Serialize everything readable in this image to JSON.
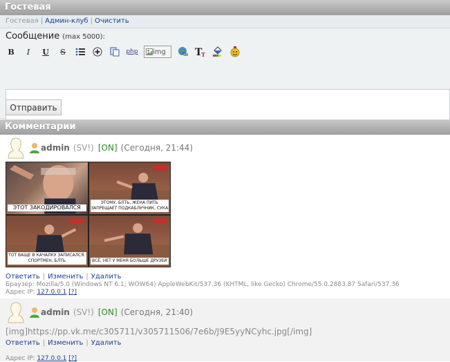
{
  "header": {
    "title": "Гостевая"
  },
  "tabs": {
    "current": "Гостевая",
    "admin_club": "Админ-клуб",
    "clear": "Очистить"
  },
  "form": {
    "label": "Сообщение",
    "max_hint": "(max 5000):",
    "toolbar": {
      "bold": "B",
      "italic": "I",
      "underline": "U",
      "strike": "S",
      "php": "php",
      "img_alt": "img",
      "font": "T"
    },
    "textarea_value": "",
    "send_label": "Отправить"
  },
  "comments_header": {
    "title": "Комментарии"
  },
  "comments": [
    {
      "author": "admin",
      "group": "(SV!)",
      "status": "[ON]",
      "date": "(Сегодня, 21:44)",
      "image_captions": [
        "ЭТОТ ЗАКОДИРОВАЛСЯ",
        "ЭТОМУ, БЛТЬ, ЖЕНА ПИТЬ ЗАПРЕЩАЕТ ПОДКАБЛУЧНИК, СУКА",
        "ТОТ ВАЩЕ В КАЧАЛКУ ЗАПИСАЛСЯ. СПОРТМЕН, БЛТЬ",
        "ВСЁ, НЕТ У МЕНЯ БОЛЬШЕ ДРУЗЕЙ"
      ],
      "actions": {
        "reply": "Ответить",
        "edit": "Изменить",
        "delete": "Удалить"
      },
      "browser_label": "Браузер:",
      "browser": "Mozilla/5.0 (Windows NT 6.1; WOW64) AppleWebKit/537.36 (KHTML, like Gecko) Chrome/55.0.2883.87 Safari/537.36",
      "ip_label": "Адрес IP:",
      "ip": "127.0.0.1",
      "ip_help": "[?]"
    },
    {
      "author": "admin",
      "group": "(SV!)",
      "status": "[ON]",
      "date": "(Сегодня, 21:40)",
      "text": "[img]https://pp.vk.me/c305711/v305711506/7e6b/J9E5yyNCyhc.jpg[/img]",
      "actions": {
        "reply": "Ответить",
        "edit": "Изменить",
        "delete": "Удалить"
      },
      "ip_label": "Адрес IP:",
      "ip": "127.0.0.1",
      "ip_help": "[?]"
    }
  ],
  "colors": {
    "header_bar": "#9e9e9e",
    "link": "#1a3e8c",
    "online": "#2e8b24",
    "form_bg": "#eef2f3"
  }
}
